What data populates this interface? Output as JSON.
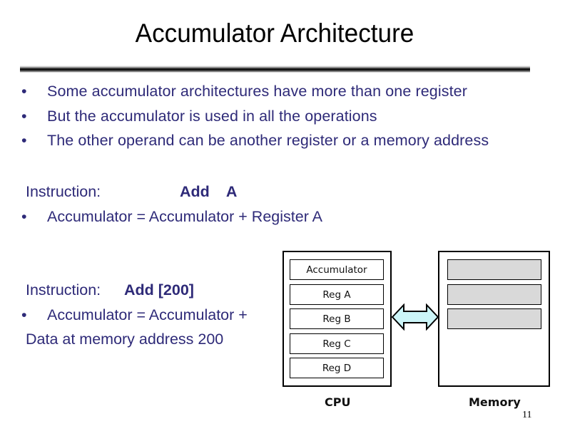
{
  "slide": {
    "title": "Accumulator Architecture",
    "bullet_glyph": "•",
    "bullets": [
      "Some accumulator architectures have more than one register",
      "But the accumulator is used in all the operations",
      "The other operand can be another register or a memory address"
    ],
    "example1": {
      "label": "Instruction:",
      "instruction": "Add    A",
      "bullet": "Accumulator = Accumulator + Register A"
    },
    "example2": {
      "label": "Instruction:",
      "instruction": "Add [200]",
      "bullet": "Accumulator = Accumulator +",
      "continuation": "Data at memory address 200"
    },
    "page_number": "11"
  },
  "diagram": {
    "cpu_label": "CPU",
    "memory_label": "Memory",
    "registers": [
      "Accumulator",
      "Reg A",
      "Reg B",
      "Reg C",
      "Reg D"
    ],
    "memory_cells": 3,
    "arrow": "bidirectional-bus-arrow",
    "colors": {
      "text": "#2e2a78",
      "arrow_fill": "#ccf5f8",
      "memory_cell_fill": "#d9d9d9"
    }
  }
}
